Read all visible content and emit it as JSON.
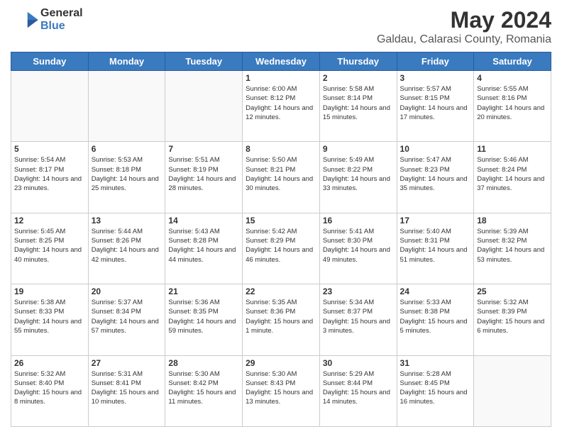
{
  "header": {
    "logo_general": "General",
    "logo_blue": "Blue",
    "month_year": "May 2024",
    "location": "Galdau, Calarasi County, Romania"
  },
  "weekdays": [
    "Sunday",
    "Monday",
    "Tuesday",
    "Wednesday",
    "Thursday",
    "Friday",
    "Saturday"
  ],
  "weeks": [
    [
      {
        "day": "",
        "info": ""
      },
      {
        "day": "",
        "info": ""
      },
      {
        "day": "",
        "info": ""
      },
      {
        "day": "1",
        "info": "Sunrise: 6:00 AM\nSunset: 8:12 PM\nDaylight: 14 hours and 12 minutes."
      },
      {
        "day": "2",
        "info": "Sunrise: 5:58 AM\nSunset: 8:14 PM\nDaylight: 14 hours and 15 minutes."
      },
      {
        "day": "3",
        "info": "Sunrise: 5:57 AM\nSunset: 8:15 PM\nDaylight: 14 hours and 17 minutes."
      },
      {
        "day": "4",
        "info": "Sunrise: 5:55 AM\nSunset: 8:16 PM\nDaylight: 14 hours and 20 minutes."
      }
    ],
    [
      {
        "day": "5",
        "info": "Sunrise: 5:54 AM\nSunset: 8:17 PM\nDaylight: 14 hours and 23 minutes."
      },
      {
        "day": "6",
        "info": "Sunrise: 5:53 AM\nSunset: 8:18 PM\nDaylight: 14 hours and 25 minutes."
      },
      {
        "day": "7",
        "info": "Sunrise: 5:51 AM\nSunset: 8:19 PM\nDaylight: 14 hours and 28 minutes."
      },
      {
        "day": "8",
        "info": "Sunrise: 5:50 AM\nSunset: 8:21 PM\nDaylight: 14 hours and 30 minutes."
      },
      {
        "day": "9",
        "info": "Sunrise: 5:49 AM\nSunset: 8:22 PM\nDaylight: 14 hours and 33 minutes."
      },
      {
        "day": "10",
        "info": "Sunrise: 5:47 AM\nSunset: 8:23 PM\nDaylight: 14 hours and 35 minutes."
      },
      {
        "day": "11",
        "info": "Sunrise: 5:46 AM\nSunset: 8:24 PM\nDaylight: 14 hours and 37 minutes."
      }
    ],
    [
      {
        "day": "12",
        "info": "Sunrise: 5:45 AM\nSunset: 8:25 PM\nDaylight: 14 hours and 40 minutes."
      },
      {
        "day": "13",
        "info": "Sunrise: 5:44 AM\nSunset: 8:26 PM\nDaylight: 14 hours and 42 minutes."
      },
      {
        "day": "14",
        "info": "Sunrise: 5:43 AM\nSunset: 8:28 PM\nDaylight: 14 hours and 44 minutes."
      },
      {
        "day": "15",
        "info": "Sunrise: 5:42 AM\nSunset: 8:29 PM\nDaylight: 14 hours and 46 minutes."
      },
      {
        "day": "16",
        "info": "Sunrise: 5:41 AM\nSunset: 8:30 PM\nDaylight: 14 hours and 49 minutes."
      },
      {
        "day": "17",
        "info": "Sunrise: 5:40 AM\nSunset: 8:31 PM\nDaylight: 14 hours and 51 minutes."
      },
      {
        "day": "18",
        "info": "Sunrise: 5:39 AM\nSunset: 8:32 PM\nDaylight: 14 hours and 53 minutes."
      }
    ],
    [
      {
        "day": "19",
        "info": "Sunrise: 5:38 AM\nSunset: 8:33 PM\nDaylight: 14 hours and 55 minutes."
      },
      {
        "day": "20",
        "info": "Sunrise: 5:37 AM\nSunset: 8:34 PM\nDaylight: 14 hours and 57 minutes."
      },
      {
        "day": "21",
        "info": "Sunrise: 5:36 AM\nSunset: 8:35 PM\nDaylight: 14 hours and 59 minutes."
      },
      {
        "day": "22",
        "info": "Sunrise: 5:35 AM\nSunset: 8:36 PM\nDaylight: 15 hours and 1 minute."
      },
      {
        "day": "23",
        "info": "Sunrise: 5:34 AM\nSunset: 8:37 PM\nDaylight: 15 hours and 3 minutes."
      },
      {
        "day": "24",
        "info": "Sunrise: 5:33 AM\nSunset: 8:38 PM\nDaylight: 15 hours and 5 minutes."
      },
      {
        "day": "25",
        "info": "Sunrise: 5:32 AM\nSunset: 8:39 PM\nDaylight: 15 hours and 6 minutes."
      }
    ],
    [
      {
        "day": "26",
        "info": "Sunrise: 5:32 AM\nSunset: 8:40 PM\nDaylight: 15 hours and 8 minutes."
      },
      {
        "day": "27",
        "info": "Sunrise: 5:31 AM\nSunset: 8:41 PM\nDaylight: 15 hours and 10 minutes."
      },
      {
        "day": "28",
        "info": "Sunrise: 5:30 AM\nSunset: 8:42 PM\nDaylight: 15 hours and 11 minutes."
      },
      {
        "day": "29",
        "info": "Sunrise: 5:30 AM\nSunset: 8:43 PM\nDaylight: 15 hours and 13 minutes."
      },
      {
        "day": "30",
        "info": "Sunrise: 5:29 AM\nSunset: 8:44 PM\nDaylight: 15 hours and 14 minutes."
      },
      {
        "day": "31",
        "info": "Sunrise: 5:28 AM\nSunset: 8:45 PM\nDaylight: 15 hours and 16 minutes."
      },
      {
        "day": "",
        "info": ""
      }
    ]
  ]
}
